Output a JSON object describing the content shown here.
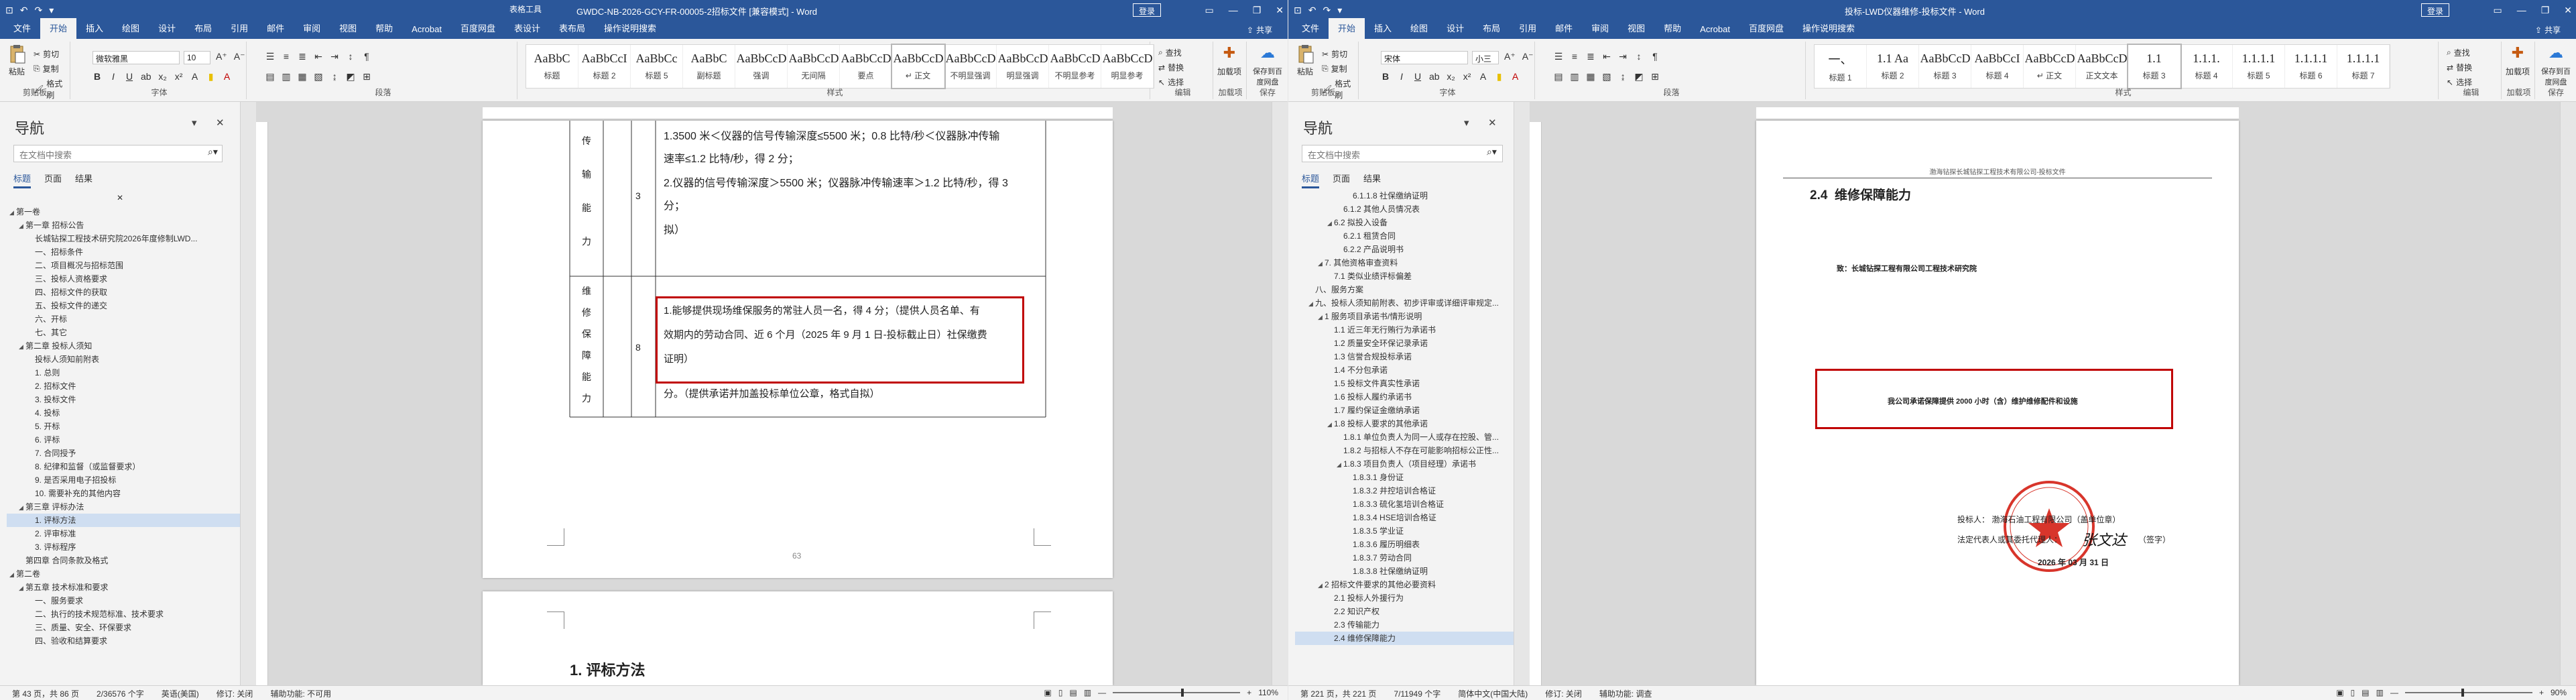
{
  "left": {
    "title": "GWDC-NB-2026-GCY-FR-00005-2招标文件 [兼容模式] - Word",
    "tool_tab": "表格工具",
    "login": "登录",
    "tabs": [
      "文件",
      "开始",
      "插入",
      "绘图",
      "设计",
      "布局",
      "引用",
      "邮件",
      "审阅",
      "视图",
      "帮助",
      "Acrobat",
      "百度网盘",
      "表设计",
      "表布局",
      "操作说明搜索"
    ],
    "share": "共享",
    "clipboard": {
      "paste": "粘贴",
      "cut": "剪切",
      "copy": "复制",
      "painter": "格式刷",
      "label": "剪贴板"
    },
    "font": {
      "name": "微软雅黑",
      "size": "10",
      "label": "字体"
    },
    "paragraph_label": "段落",
    "styles": [
      {
        "preview": "AaBbC",
        "name": "标题"
      },
      {
        "preview": "AaBbCcI",
        "name": "标题 2"
      },
      {
        "preview": "AaBbCc",
        "name": "标题 5"
      },
      {
        "preview": "AaBbC",
        "name": "副标题"
      },
      {
        "preview": "AaBbCcDd",
        "name": "强调"
      },
      {
        "preview": "AaBbCcDd",
        "name": "无间隔"
      },
      {
        "preview": "AaBbCcDd",
        "name": "要点"
      },
      {
        "preview": "AaBbCcDd",
        "name": "↵ 正文"
      },
      {
        "preview": "AaBbCcDd",
        "name": "不明显强调"
      },
      {
        "preview": "AaBbCcDd",
        "name": "明显强调"
      },
      {
        "preview": "AaBbCcDd",
        "name": "不明显参考"
      },
      {
        "preview": "AaBbCcDd",
        "name": "明显参考"
      }
    ],
    "styles_label": "样式",
    "editing": {
      "find": "查找",
      "replace": "替换",
      "select": "选择",
      "label": "编辑"
    },
    "addins": {
      "btn": "加载项",
      "label": "加载项"
    },
    "save_baidu": {
      "btn": "保存到百度网盘",
      "label": "保存"
    },
    "nav": {
      "title": "导航",
      "search_placeholder": "在文档中搜索",
      "tabs": [
        "标题",
        "页面",
        "结果"
      ],
      "items": [
        {
          "t": "第一卷",
          "lvl": 0,
          "arrow": "◢"
        },
        {
          "t": "第一章 招标公告",
          "lvl": 1,
          "arrow": "◢"
        },
        {
          "t": "长城钻探工程技术研究院2026年度修制LWD...",
          "lvl": 2,
          "arrow": ""
        },
        {
          "t": "一、招标条件",
          "lvl": 2,
          "arrow": ""
        },
        {
          "t": "二、项目概况与招标范围",
          "lvl": 2,
          "arrow": ""
        },
        {
          "t": "三、投标人资格要求",
          "lvl": 2,
          "arrow": ""
        },
        {
          "t": "四、招标文件的获取",
          "lvl": 2,
          "arrow": ""
        },
        {
          "t": "五、投标文件的递交",
          "lvl": 2,
          "arrow": ""
        },
        {
          "t": "六、开标",
          "lvl": 2,
          "arrow": ""
        },
        {
          "t": "七、其它",
          "lvl": 2,
          "arrow": ""
        },
        {
          "t": "第二章 投标人须知",
          "lvl": 1,
          "arrow": "◢"
        },
        {
          "t": "投标人须知前附表",
          "lvl": 2,
          "arrow": ""
        },
        {
          "t": "1. 总则",
          "lvl": 2,
          "arrow": ""
        },
        {
          "t": "2. 招标文件",
          "lvl": 2,
          "arrow": ""
        },
        {
          "t": "3. 投标文件",
          "lvl": 2,
          "arrow": ""
        },
        {
          "t": "4. 投标",
          "lvl": 2,
          "arrow": ""
        },
        {
          "t": "5. 开标",
          "lvl": 2,
          "arrow": ""
        },
        {
          "t": "6. 评标",
          "lvl": 2,
          "arrow": ""
        },
        {
          "t": "7. 合同授予",
          "lvl": 2,
          "arrow": ""
        },
        {
          "t": "8. 纪律和监督（或监督要求）",
          "lvl": 2,
          "arrow": ""
        },
        {
          "t": "9. 是否采用电子招投标",
          "lvl": 2,
          "arrow": ""
        },
        {
          "t": "10. 需要补充的其他内容",
          "lvl": 2,
          "arrow": ""
        },
        {
          "t": "第三章 评标办法",
          "lvl": 1,
          "arrow": "◢"
        },
        {
          "t": "1. 评标方法",
          "lvl": 2,
          "arrow": "",
          "current": true
        },
        {
          "t": "2. 评审标准",
          "lvl": 2,
          "arrow": ""
        },
        {
          "t": "3. 评标程序",
          "lvl": 2,
          "arrow": ""
        },
        {
          "t": "第四章 合同条款及格式",
          "lvl": 1,
          "arrow": ""
        },
        {
          "t": "第二卷",
          "lvl": 0,
          "arrow": "◢"
        },
        {
          "t": "第五章 技术标准和要求",
          "lvl": 1,
          "arrow": "◢"
        },
        {
          "t": "一、服务要求",
          "lvl": 2,
          "arrow": ""
        },
        {
          "t": "二、执行的技术规范标准、技术要求",
          "lvl": 2,
          "arrow": ""
        },
        {
          "t": "三、质量、安全、环保要求",
          "lvl": 2,
          "arrow": ""
        },
        {
          "t": "四、验收和结算要求",
          "lvl": 2,
          "arrow": ""
        }
      ]
    },
    "doc": {
      "row1_label": [
        "传",
        "输",
        "能",
        "力"
      ],
      "row1_num": "3",
      "row1_lines": [
        "1.3500 米＜仪器的信号传输深度≤5500 米；0.8 比特/秒＜仪器脉冲传输",
        "速率≤1.2 比特/秒，得 2 分；",
        "2.仪器的信号传输深度＞5500 米；仪器脉冲传输速率＞1.2 比特/秒，得 3",
        "分；",
        "拟）"
      ],
      "row2_label": [
        "维",
        "修",
        "保",
        "障",
        "能",
        "力"
      ],
      "row2_num": "8",
      "row2_lines": [
        "1.能够提供现场维保服务的常驻人员一名，得 4 分；（提供人员名单、有",
        "效期内的劳动合同、近 6 个月（2025 年 9 月 1 日-投标截止日）社保缴费",
        "证明）",
        "分。（提供承诺并加盖投标单位公章，格式自拟）"
      ],
      "page_num": "63",
      "next_heading": "1. 评标方法"
    },
    "status": {
      "page": "第 43 页，共 86 页",
      "words": "2/36576 个字",
      "lang": "英语(美国)",
      "track": "修订: 关闭",
      "access": "辅助功能: 不可用",
      "zoom": "110%",
      "zoom_value": 110
    }
  },
  "right": {
    "title": "投标-LWD仪器维修-投标文件 - Word",
    "login": "登录",
    "tabs": [
      "文件",
      "开始",
      "插入",
      "绘图",
      "设计",
      "布局",
      "引用",
      "邮件",
      "审阅",
      "视图",
      "帮助",
      "Acrobat",
      "百度网盘",
      "操作说明搜索"
    ],
    "share": "共享",
    "clipboard": {
      "paste": "粘贴",
      "cut": "剪切",
      "copy": "复制",
      "painter": "格式刷",
      "label": "剪贴板"
    },
    "font": {
      "name": "宋体",
      "size": "小三",
      "label": "字体"
    },
    "paragraph_label": "段落",
    "styles": [
      {
        "preview": "一、",
        "name": "标题 1"
      },
      {
        "preview": "1.1 Aa",
        "name": "标题 2"
      },
      {
        "preview": "AaBbCcD",
        "name": "标题 3"
      },
      {
        "preview": "AaBbCcI",
        "name": "标题 4"
      },
      {
        "preview": "AaBbCcDd",
        "name": "↵ 正文"
      },
      {
        "preview": "AaBbCcDd",
        "name": "正文文本"
      },
      {
        "preview": "1.1",
        "name": "标题 3"
      },
      {
        "preview": "1.1.1.",
        "name": "标题 4"
      },
      {
        "preview": "1.1.1.1",
        "name": "标题 5"
      },
      {
        "preview": "1.1.1.1",
        "name": "标题 6"
      },
      {
        "preview": "1.1.1.1",
        "name": "标题 7"
      }
    ],
    "styles_label": "样式",
    "editing": {
      "find": "查找",
      "replace": "替换",
      "select": "选择",
      "label": "编辑"
    },
    "addins": {
      "btn": "加载项",
      "label": "加载项"
    },
    "save_baidu": {
      "btn": "保存到百度网盘",
      "label": "保存"
    },
    "nav": {
      "title": "导航",
      "search_placeholder": "在文档中搜索",
      "tabs": [
        "标题",
        "页面",
        "结果"
      ],
      "items": [
        {
          "t": "6.1.1.8 社保缴纳证明",
          "lvl": 4,
          "arrow": ""
        },
        {
          "t": "6.1.2 其他人员情况表",
          "lvl": 3,
          "arrow": ""
        },
        {
          "t": "6.2 拟投入设备",
          "lvl": 2,
          "arrow": "◢"
        },
        {
          "t": "6.2.1 租赁合同",
          "lvl": 3,
          "arrow": ""
        },
        {
          "t": "6.2.2 产品说明书",
          "lvl": 3,
          "arrow": ""
        },
        {
          "t": "7. 其他资格审查资料",
          "lvl": 1,
          "arrow": "◢"
        },
        {
          "t": "7.1 类似业绩评标偏差",
          "lvl": 2,
          "arrow": ""
        },
        {
          "t": "八、服务方案",
          "lvl": 0,
          "arrow": ""
        },
        {
          "t": "九、投标人须知前附表、初步评审或详细评审规定...",
          "lvl": 0,
          "arrow": "◢"
        },
        {
          "t": "1 服务项目承诺书/情形说明",
          "lvl": 1,
          "arrow": "◢"
        },
        {
          "t": "1.1 近三年无行贿行为承诺书",
          "lvl": 2,
          "arrow": ""
        },
        {
          "t": "1.2 质量安全环保记录承诺",
          "lvl": 2,
          "arrow": ""
        },
        {
          "t": "1.3 信誉合规投标承诺",
          "lvl": 2,
          "arrow": ""
        },
        {
          "t": "1.4 不分包承诺",
          "lvl": 2,
          "arrow": ""
        },
        {
          "t": "1.5 投标文件真实性承诺",
          "lvl": 2,
          "arrow": ""
        },
        {
          "t": "1.6 投标人履约承诺书",
          "lvl": 2,
          "arrow": ""
        },
        {
          "t": "1.7 履约保证金缴纳承诺",
          "lvl": 2,
          "arrow": ""
        },
        {
          "t": "1.8 投标人要求的其他承诺",
          "lvl": 2,
          "arrow": "◢"
        },
        {
          "t": "1.8.1 单位负责人为同一人或存在控股、管...",
          "lvl": 3,
          "arrow": ""
        },
        {
          "t": "1.8.2 与招标人不存在可能影响招标公正性...",
          "lvl": 3,
          "arrow": ""
        },
        {
          "t": "1.8.3 项目负责人（项目经理）承诺书",
          "lvl": 3,
          "arrow": "◢"
        },
        {
          "t": "1.8.3.1 身份证",
          "lvl": 4,
          "arrow": ""
        },
        {
          "t": "1.8.3.2 井控培训合格证",
          "lvl": 4,
          "arrow": ""
        },
        {
          "t": "1.8.3.3 硫化氢培训合格证",
          "lvl": 4,
          "arrow": ""
        },
        {
          "t": "1.8.3.4 HSE培训合格证",
          "lvl": 4,
          "arrow": ""
        },
        {
          "t": "1.8.3.5 学业证",
          "lvl": 4,
          "arrow": ""
        },
        {
          "t": "1.8.3.6 履历明细表",
          "lvl": 4,
          "arrow": ""
        },
        {
          "t": "1.8.3.7 劳动合同",
          "lvl": 4,
          "arrow": ""
        },
        {
          "t": "1.8.3.8 社保缴纳证明",
          "lvl": 4,
          "arrow": ""
        },
        {
          "t": "2 招标文件要求的其他必要资料",
          "lvl": 1,
          "arrow": "◢"
        },
        {
          "t": "2.1 投标人外援行为",
          "lvl": 2,
          "arrow": ""
        },
        {
          "t": "2.2 知识产权",
          "lvl": 2,
          "arrow": ""
        },
        {
          "t": "2.3 传输能力",
          "lvl": 2,
          "arrow": ""
        },
        {
          "t": "2.4 维修保障能力",
          "lvl": 2,
          "arrow": "",
          "current": true
        }
      ]
    },
    "doc": {
      "header_text": "渤海钻探长城钻探工程技术有限公司-投标文件",
      "heading_num": "2.4",
      "heading_text": "维修保障能力",
      "to_line": "致：长城钻探工程有限公司工程技术研究院",
      "promise": "我公司承诺保障提供 2000 小时（含）维护维修配件和设施",
      "bidder": "投标人：  渤海石油工程有限公司（盖单位章）",
      "rep": "法定代表人或其委托代理人：",
      "sign_suffix": "（签字）",
      "date": "2026 年 03 月 31 日",
      "signature": "张文达"
    },
    "status": {
      "page": "第 221 页，共 221 页",
      "words": "7/11949 个字",
      "lang": "简体中文(中国大陆)",
      "track": "修订: 关闭",
      "access": "辅助功能: 调查",
      "zoom": "90%",
      "zoom_value": 90
    }
  },
  "colors": {
    "brand": "#2b579a",
    "highlight": "#c00000",
    "stamp": "#d8352b"
  }
}
